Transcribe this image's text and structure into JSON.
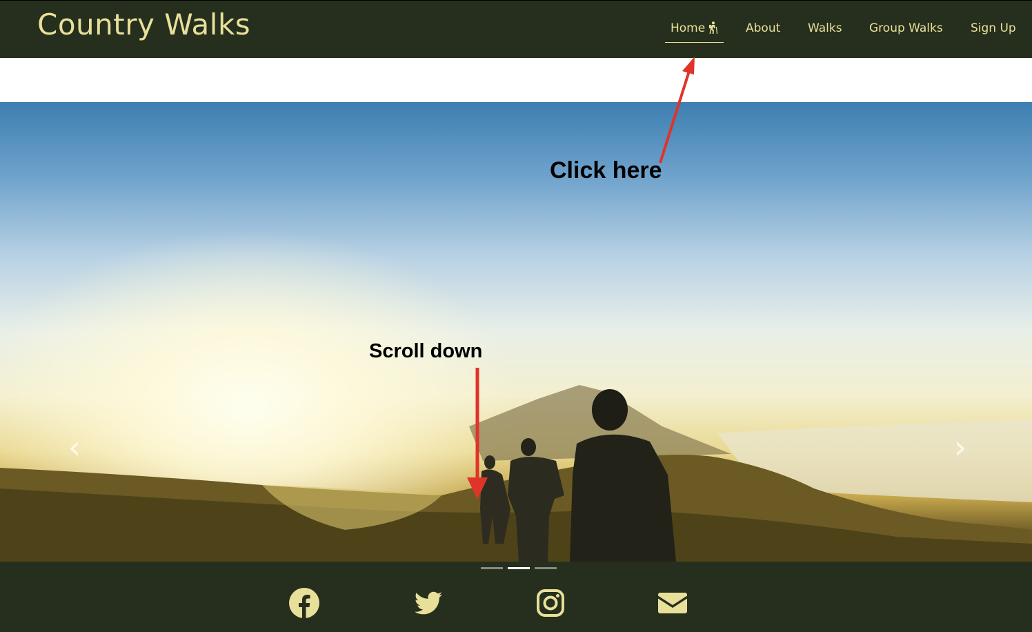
{
  "nav": {
    "brand": "Country Walks",
    "links": [
      {
        "label": "Home",
        "active": true
      },
      {
        "label": "About"
      },
      {
        "label": "Walks"
      },
      {
        "label": "Group Walks"
      },
      {
        "label": "Sign Up"
      }
    ]
  },
  "carousel": {
    "prev_icon": "chevron-left-icon",
    "next_icon": "chevron-right-icon",
    "indicators": [
      {
        "active": false
      },
      {
        "active": true
      },
      {
        "active": false
      }
    ]
  },
  "annotations": {
    "click_here": "Click here",
    "scroll_down": "Scroll down",
    "arrow_color": "#e0332a"
  },
  "footer": {
    "social": [
      "facebook-icon",
      "twitter-icon",
      "instagram-icon",
      "envelope-icon"
    ]
  },
  "colors": {
    "nav_bg": "#262f1d",
    "accent": "#e8e09a"
  }
}
